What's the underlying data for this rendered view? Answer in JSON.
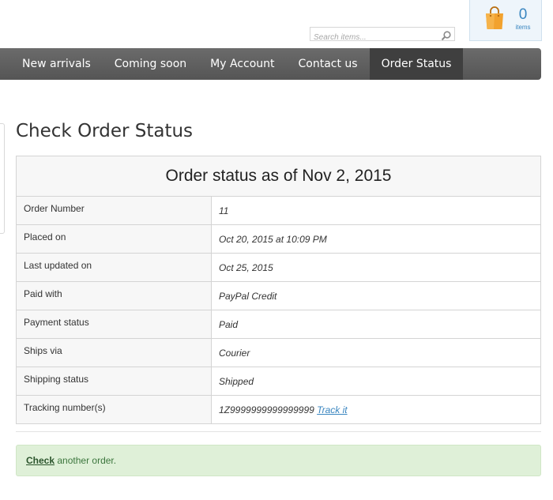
{
  "header": {
    "search": {
      "placeholder": "Search items...",
      "icon": "search-icon"
    },
    "cart": {
      "count": "0",
      "label": "items",
      "icon": "shopping-bag-icon",
      "icon_color": "#f0a030"
    }
  },
  "nav": {
    "items": [
      {
        "label": "New arrivals"
      },
      {
        "label": "Coming soon"
      },
      {
        "label": "My Account"
      },
      {
        "label": "Contact us"
      },
      {
        "label": "Order Status",
        "active": true
      }
    ]
  },
  "main": {
    "title": "Check Order Status",
    "table": {
      "heading": "Order status as of Nov 2, 2015",
      "rows": [
        {
          "label": "Order Number",
          "value": "11"
        },
        {
          "label": "Placed on",
          "value": "Oct 20, 2015 at 10:09 PM"
        },
        {
          "label": "Last updated on",
          "value": "Oct 25, 2015"
        },
        {
          "label": "Paid with",
          "value": "PayPal Credit"
        },
        {
          "label": "Payment status",
          "value": "Paid"
        },
        {
          "label": "Ships via",
          "value": "Courier"
        },
        {
          "label": "Shipping status",
          "value": "Shipped"
        },
        {
          "label": "Tracking number(s)",
          "value": "1Z9999999999999999",
          "link": "Track it"
        }
      ]
    },
    "alert": {
      "link": "Check",
      "text": " another order."
    }
  },
  "colors": {
    "nav_bg": "#5f5f5f",
    "nav_active_bg": "#3f3f3f",
    "link": "#3a86c0",
    "alert_bg": "#dff0d8",
    "alert_text": "#3c763d"
  }
}
